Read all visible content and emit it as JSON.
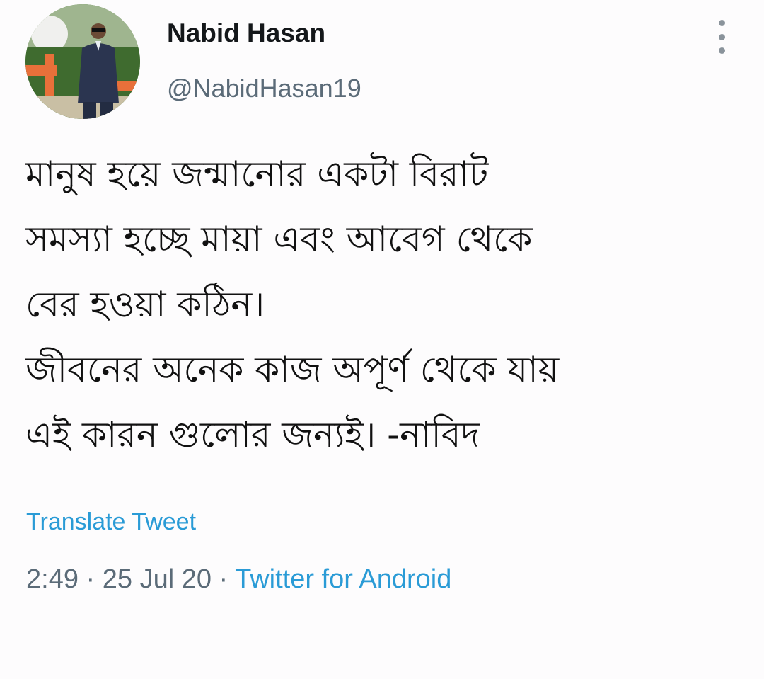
{
  "tweet": {
    "author": {
      "name": "Nabid Hasan",
      "handle": "@NabidHasan19"
    },
    "text_lines": [
      "মানুষ হয়ে জন্মানোর একটা বিরাট",
      "সমস্যা হচ্ছে মায়া এবং আবেগ থেকে",
      "বের হওয়া কঠিন।",
      "জীবনের অনেক কাজ অপূর্ণ থেকে যায়",
      "এই কারন গুলোর জন্যই। -নাবিদ"
    ],
    "translate_label": "Translate Tweet",
    "time": "2:49",
    "separator": " · ",
    "date": "25 Jul 20",
    "source": "Twitter for Android"
  },
  "icons": {
    "more": "more-vertical-icon"
  },
  "colors": {
    "link": "#2a9bd6",
    "muted": "#5b6b78",
    "background": "#fdfcfd"
  }
}
